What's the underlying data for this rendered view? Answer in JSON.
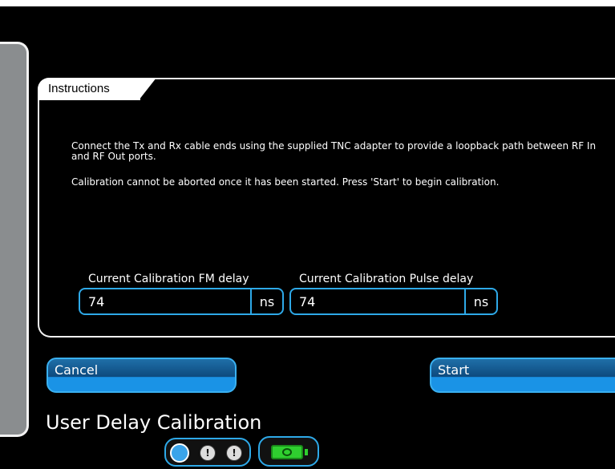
{
  "instructions": {
    "heading": "Instructions",
    "paragraph_1": "Connect the Tx and Rx cable ends using the supplied TNC adapter to provide a loopback path between RF In and RF Out ports.",
    "paragraph_2": "Calibration cannot be aborted once it has been started. Press 'Start' to begin calibration."
  },
  "fields": {
    "fm_delay": {
      "label": "Current Calibration FM delay",
      "value": "74",
      "unit": "ns"
    },
    "pulse_delay": {
      "label": "Current Calibration Pulse delay",
      "value": "74",
      "unit": "ns"
    }
  },
  "buttons": {
    "cancel": "Cancel",
    "start": "Start"
  },
  "page_title": "User Delay Calibration",
  "status": {
    "indicator_icons": [
      "active-indicator-icon",
      "info-indicator-icon",
      "alert-indicator-icon"
    ],
    "info_glyph": "!",
    "alert_glyph": "!",
    "battery_icon": "battery-icon"
  },
  "colors": {
    "accent": "#2ea9e8",
    "button_fill": "#1a93e6",
    "battery": "#2fcf2f",
    "background": "#000000"
  }
}
